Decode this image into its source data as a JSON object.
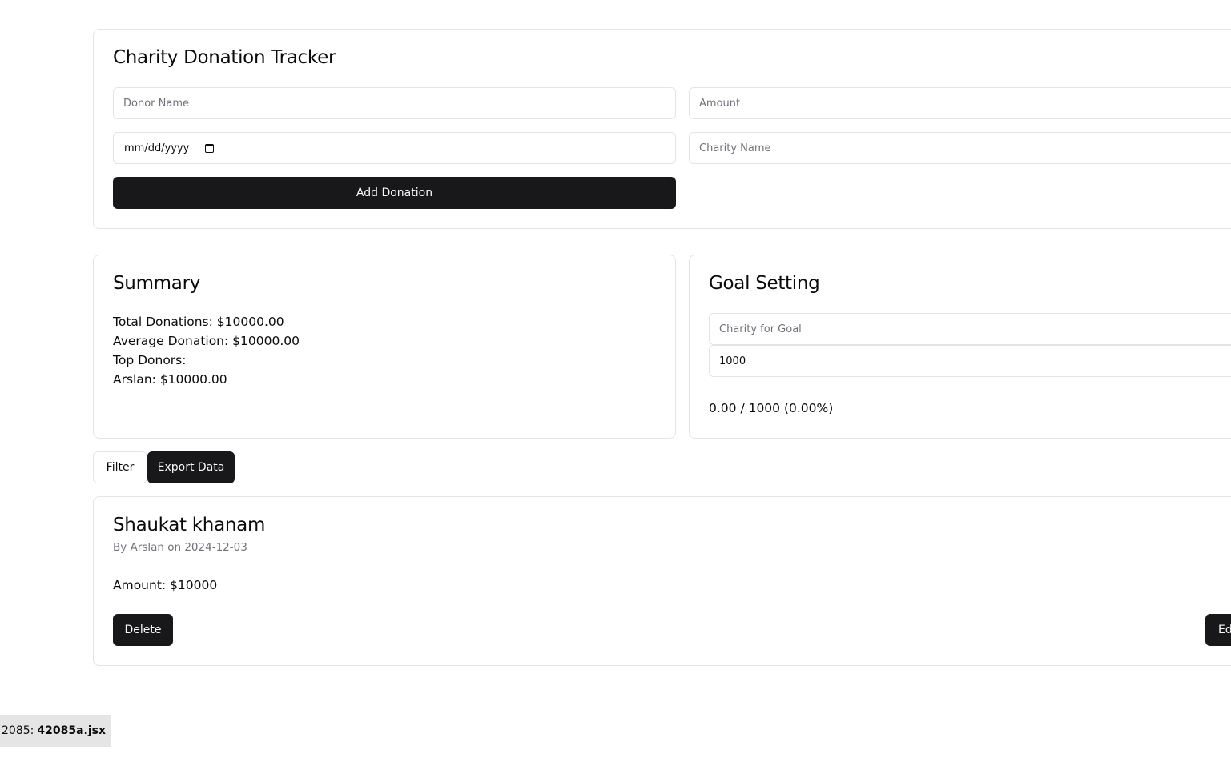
{
  "tracker": {
    "title": "Charity Donation Tracker",
    "donor_name_placeholder": "Donor Name",
    "amount_placeholder": "Amount",
    "date_placeholder": "mm/dd/yyyy",
    "charity_name_placeholder": "Charity Name",
    "add_button": "Add Donation"
  },
  "summary": {
    "title": "Summary",
    "total": "Total Donations: $10000.00",
    "average": "Average Donation: $10000.00",
    "top_donors_label": "Top Donors:",
    "top_donors": [
      "Arslan: $10000.00"
    ]
  },
  "goal": {
    "title": "Goal Setting",
    "charity_placeholder": "Charity for Goal",
    "amount_value": "1000",
    "progress_text": "0.00 / 1000 (0.00%)"
  },
  "actions": {
    "filter_label": "Filter",
    "export_label": "Export Data"
  },
  "donations": [
    {
      "charity": "Shaukat khanam",
      "meta": "By Arslan on 2024-12-03",
      "amount": "Amount: $10000",
      "delete_label": "Delete",
      "edit_label": "Edit"
    }
  ],
  "footer": {
    "prefix": "2085:",
    "filename": "42085a.jsx"
  },
  "colors": {
    "primary": "#18181b",
    "border": "#e4e4e7",
    "muted_text": "#71717a"
  }
}
